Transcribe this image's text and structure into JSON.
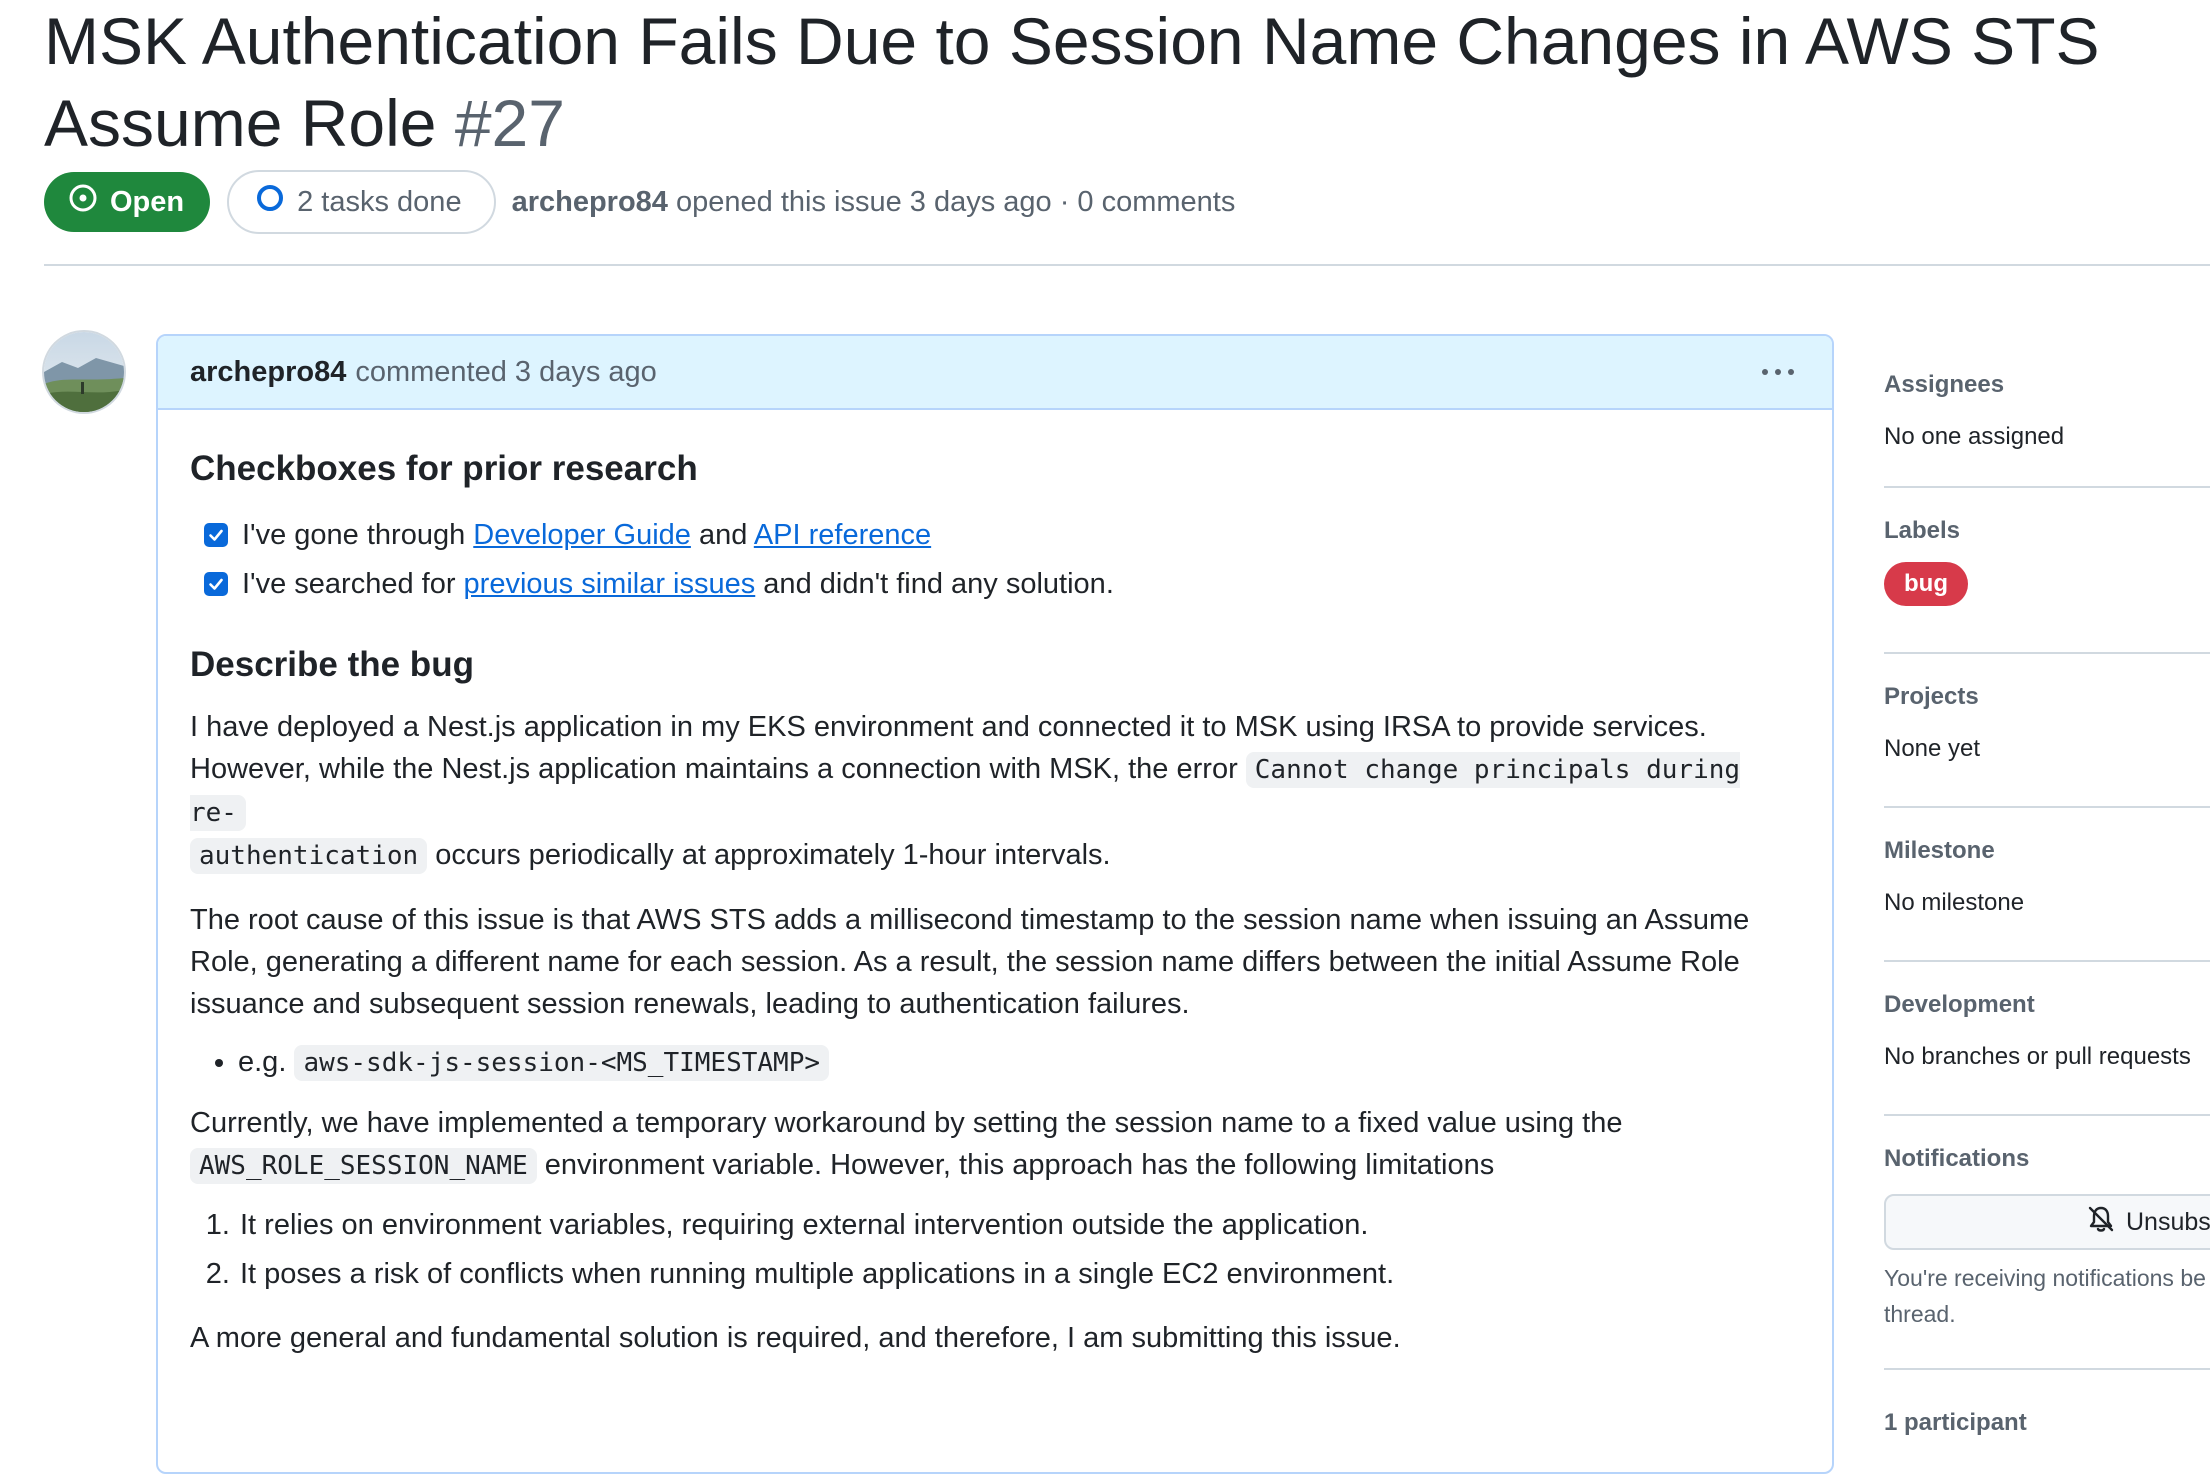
{
  "issue": {
    "title": "MSK Authentication Fails Due to Session Name Changes in AWS STS Assume Role",
    "number": "#27",
    "state": "Open",
    "tasks": "2 tasks done",
    "author": "archepro84",
    "opened_text": "opened this issue 3 days ago · 0 comments"
  },
  "comment": {
    "author": "archepro84",
    "meta": "commented 3 days ago",
    "heading_research": "Checkboxes for prior research",
    "checks": [
      {
        "pre": "I've gone through ",
        "link1": "Developer Guide",
        "mid": " and ",
        "link2": "API reference",
        "post": ""
      },
      {
        "pre": "I've searched for ",
        "link1": "previous similar issues",
        "post": " and didn't find any solution."
      }
    ],
    "heading_bug": "Describe the bug",
    "p1_a": "I have deployed a Nest.js application in my EKS environment and connected it to MSK using IRSA to provide services. However, while the Nest.js application maintains a connection with MSK, the error ",
    "p1_code1": "Cannot change principals during re-",
    "p1_code2": "authentication",
    "p1_b": " occurs periodically at approximately 1-hour intervals.",
    "p2": "The root cause of this issue is that AWS STS adds a millisecond timestamp to the session name when issuing an Assume Role, generating a different name for each session. As a result, the session name differs between the initial Assume Role issuance and subsequent session renewals, leading to authentication failures.",
    "bullet_prefix": "e.g. ",
    "bullet_code": "aws-sdk-js-session-<MS_TIMESTAMP>",
    "p3_a": "Currently, we have implemented a temporary workaround by setting the session name to a fixed value using the",
    "p3_code": "AWS_ROLE_SESSION_NAME",
    "p3_b": " environment variable. However, this approach has the following limitations",
    "limitations": [
      "It relies on environment variables, requiring external intervention outside the application.",
      "It poses a risk of conflicts when running multiple applications in a single EC2 environment."
    ],
    "p4": "A more general and fundamental solution is required, and therefore, I am submitting this issue."
  },
  "sidebar": {
    "assignees": {
      "heading": "Assignees",
      "value": "No one assigned"
    },
    "labels": {
      "heading": "Labels",
      "bug": "bug",
      "bug_color": "#d73a4a"
    },
    "projects": {
      "heading": "Projects",
      "value": "None yet"
    },
    "milestone": {
      "heading": "Milestone",
      "value": "No milestone"
    },
    "development": {
      "heading": "Development",
      "value": "No branches or pull requests"
    },
    "notifications": {
      "heading": "Notifications",
      "button": "Unsubs",
      "note_line1": "You're receiving notifications be",
      "note_line2": "thread."
    },
    "participants": {
      "heading": "1 participant"
    }
  },
  "colors": {
    "open_green": "#1f883d",
    "link_blue": "#0969da",
    "comment_header_bg": "#ddf4ff",
    "comment_border": "#b6d4fb"
  },
  "icons": [
    "issue-open-icon",
    "task-progress-icon",
    "kebab-icon",
    "checkbox-checked-icon",
    "bell-slash-icon"
  ]
}
